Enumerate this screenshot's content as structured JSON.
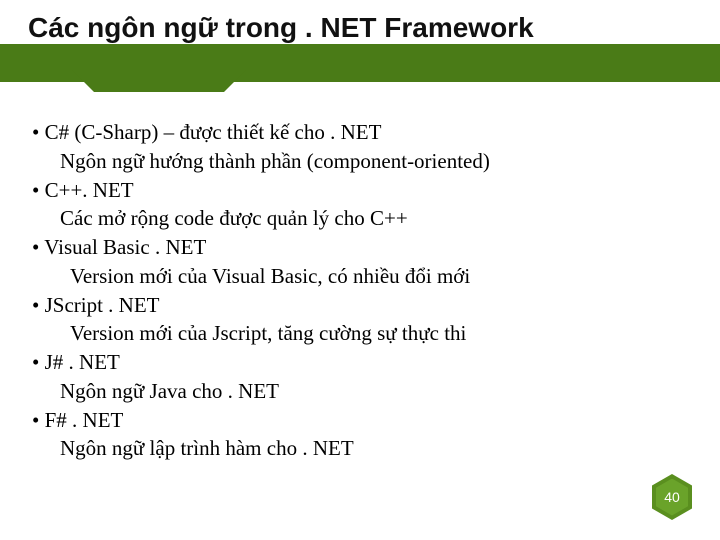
{
  "title": "Các ngôn ngữ trong . NET Framework",
  "bullets": [
    {
      "head": "• C# (C-Sharp) – được thiết kế cho . NET",
      "sub": "Ngôn ngữ hướng thành phần (component-oriented)"
    },
    {
      "head": "• C++. NET",
      "sub": "Các mở rộng code được quản lý cho C++"
    },
    {
      "head": "• Visual Basic . NET",
      "sub": "Version mới của Visual Basic, có nhiều đổi mới"
    },
    {
      "head": "• JScript . NET",
      "sub": "Version mới của Jscript, tăng cường sự thực thi"
    },
    {
      "head": "• J# . NET",
      "sub": "Ngôn ngữ Java cho . NET"
    },
    {
      "head": "• F# . NET",
      "sub": "Ngôn ngữ lập trình hàm cho . NET"
    }
  ],
  "page_number": "40",
  "colors": {
    "band": "#4a7b17",
    "hex_outer": "#5a8f1f",
    "hex_inner": "#6aa32a"
  }
}
